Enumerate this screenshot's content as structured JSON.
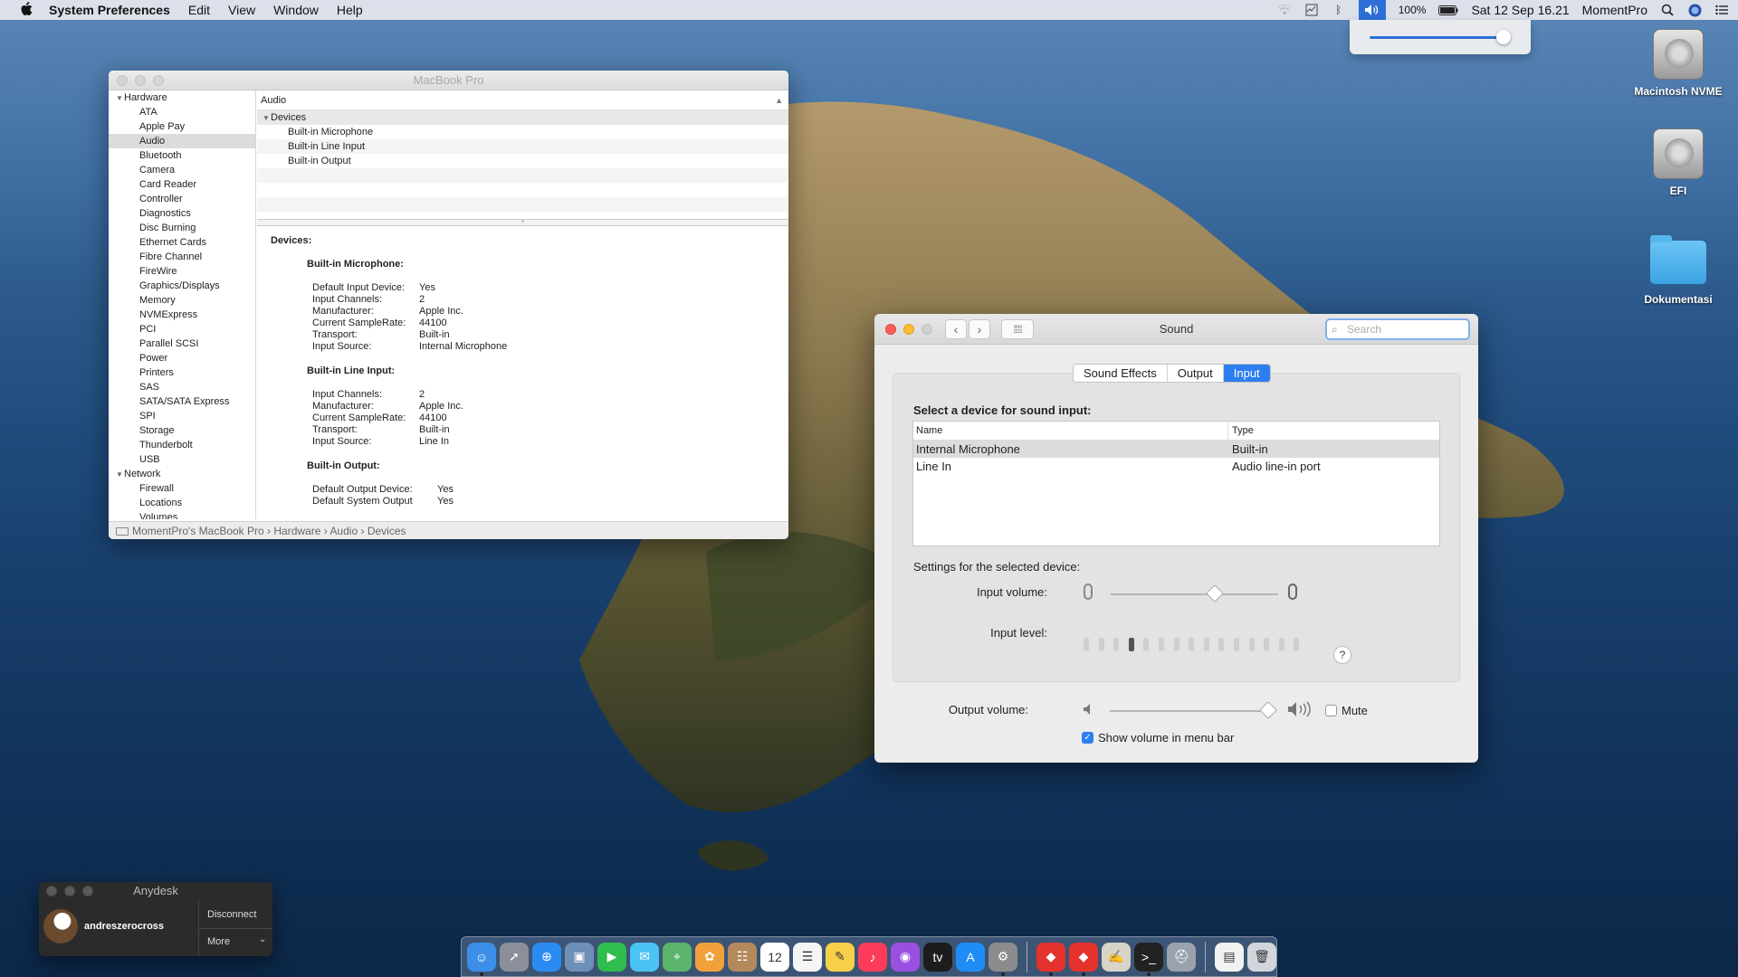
{
  "menubar": {
    "app": "System Preferences",
    "items": [
      "Edit",
      "View",
      "Window",
      "Help"
    ],
    "battery": "100%",
    "datetime": "Sat 12 Sep  16.21",
    "user": "MomentPro"
  },
  "desktop": {
    "icons": [
      {
        "label": "Macintosh NVME"
      },
      {
        "label": "EFI"
      },
      {
        "label": "Dokumentasi"
      }
    ]
  },
  "sysinfo": {
    "title": "MacBook Pro",
    "sidebar": [
      {
        "label": "Hardware",
        "group": true
      },
      {
        "label": "ATA"
      },
      {
        "label": "Apple Pay"
      },
      {
        "label": "Audio",
        "selected": true
      },
      {
        "label": "Bluetooth"
      },
      {
        "label": "Camera"
      },
      {
        "label": "Card Reader"
      },
      {
        "label": "Controller"
      },
      {
        "label": "Diagnostics"
      },
      {
        "label": "Disc Burning"
      },
      {
        "label": "Ethernet Cards"
      },
      {
        "label": "Fibre Channel"
      },
      {
        "label": "FireWire"
      },
      {
        "label": "Graphics/Displays"
      },
      {
        "label": "Memory"
      },
      {
        "label": "NVMExpress"
      },
      {
        "label": "PCI"
      },
      {
        "label": "Parallel SCSI"
      },
      {
        "label": "Power"
      },
      {
        "label": "Printers"
      },
      {
        "label": "SAS"
      },
      {
        "label": "SATA/SATA Express"
      },
      {
        "label": "SPI"
      },
      {
        "label": "Storage"
      },
      {
        "label": "Thunderbolt"
      },
      {
        "label": "USB"
      },
      {
        "label": "Network",
        "group": true
      },
      {
        "label": "Firewall"
      },
      {
        "label": "Locations"
      },
      {
        "label": "Volumes"
      }
    ],
    "pane_header": "Audio",
    "tree_group": "Devices",
    "tree_items": [
      "Built-in Microphone",
      "Built-in Line Input",
      "Built-in Output"
    ],
    "detail": {
      "heading": "Devices:",
      "mic_title": "Built-in Microphone:",
      "mic": [
        [
          "Default Input Device:",
          "Yes"
        ],
        [
          "Input Channels:",
          "2"
        ],
        [
          "Manufacturer:",
          "Apple Inc."
        ],
        [
          "Current SampleRate:",
          "44100"
        ],
        [
          "Transport:",
          "Built-in"
        ],
        [
          "Input Source:",
          "Internal Microphone"
        ]
      ],
      "line_title": "Built-in Line Input:",
      "line": [
        [
          "Input Channels:",
          "2"
        ],
        [
          "Manufacturer:",
          "Apple Inc."
        ],
        [
          "Current SampleRate:",
          "44100"
        ],
        [
          "Transport:",
          "Built-in"
        ],
        [
          "Input Source:",
          "Line In"
        ]
      ],
      "out_title": "Built-in Output:",
      "out": [
        [
          "Default Output Device:",
          "Yes"
        ],
        [
          "Default System Output Device:",
          "Yes"
        ]
      ]
    },
    "breadcrumb": [
      "MomentPro's MacBook Pro",
      "Hardware",
      "Audio",
      "Devices"
    ]
  },
  "sound": {
    "title": "Sound",
    "search_placeholder": "Search",
    "tabs": [
      "Sound Effects",
      "Output",
      "Input"
    ],
    "active_tab": "Input",
    "select_label": "Select a device for sound input:",
    "col_name": "Name",
    "col_type": "Type",
    "devices": [
      {
        "name": "Internal Microphone",
        "type": "Built-in",
        "selected": true
      },
      {
        "name": "Line In",
        "type": "Audio line-in port"
      }
    ],
    "settings_label": "Settings for the selected device:",
    "input_volume_label": "Input volume:",
    "input_volume": 0.62,
    "input_level_label": "Input level:",
    "input_level_bars": 15,
    "input_level_active": 4,
    "help": "?",
    "output_volume_label": "Output volume:",
    "output_volume": 0.97,
    "mute_label": "Mute",
    "show_volume_label": "Show volume in menu bar"
  },
  "menubar_volume": 0.95,
  "anydesk": {
    "title": "Anydesk",
    "user": "andreszerocross",
    "disconnect": "Disconnect",
    "more": "More"
  },
  "dock": {
    "items": [
      {
        "name": "finder",
        "color": "#3d8ee8",
        "glyph": "☺"
      },
      {
        "name": "launchpad",
        "color": "#8a8f99",
        "glyph": "➚"
      },
      {
        "name": "safari",
        "color": "#2a8cf0",
        "glyph": "⊕"
      },
      {
        "name": "preview",
        "color": "#6e8fb8",
        "glyph": "▣"
      },
      {
        "name": "facetime",
        "color": "#2fbd4e",
        "glyph": "▶"
      },
      {
        "name": "messages",
        "color": "#4bc3f5",
        "glyph": "✉"
      },
      {
        "name": "maps",
        "color": "#5ab56b",
        "glyph": "⌖"
      },
      {
        "name": "photos",
        "color": "#f2a13a",
        "glyph": "✿"
      },
      {
        "name": "contacts",
        "color": "#b48a5c",
        "glyph": "☷"
      },
      {
        "name": "calendar",
        "color": "#ffffff",
        "glyph": "12"
      },
      {
        "name": "reminders",
        "color": "#f5f5f5",
        "glyph": "☰"
      },
      {
        "name": "notes",
        "color": "#f7d04a",
        "glyph": "✎"
      },
      {
        "name": "music",
        "color": "#fc3c5a",
        "glyph": "♪"
      },
      {
        "name": "podcasts",
        "color": "#9b4fe0",
        "glyph": "◉"
      },
      {
        "name": "tv",
        "color": "#1c1c1c",
        "glyph": "tv"
      },
      {
        "name": "app-store",
        "color": "#1e8df5",
        "glyph": "A"
      },
      {
        "name": "system-preferences",
        "color": "#8c8c8c",
        "glyph": "⚙"
      },
      {
        "name": "anydesk",
        "color": "#e5322d",
        "glyph": "◆"
      },
      {
        "name": "anydesk-2",
        "color": "#e5322d",
        "glyph": "◆"
      },
      {
        "name": "script-editor",
        "color": "#d9d4c7",
        "glyph": "✍"
      },
      {
        "name": "terminal",
        "color": "#222222",
        "glyph": ">_"
      },
      {
        "name": "disk-utility",
        "color": "#9aa3ad",
        "glyph": "⛑"
      },
      {
        "name": "documents",
        "color": "#f2f2f2",
        "glyph": "▤"
      },
      {
        "name": "trash",
        "color": "#d0d6dc",
        "glyph": "🗑"
      }
    ]
  }
}
